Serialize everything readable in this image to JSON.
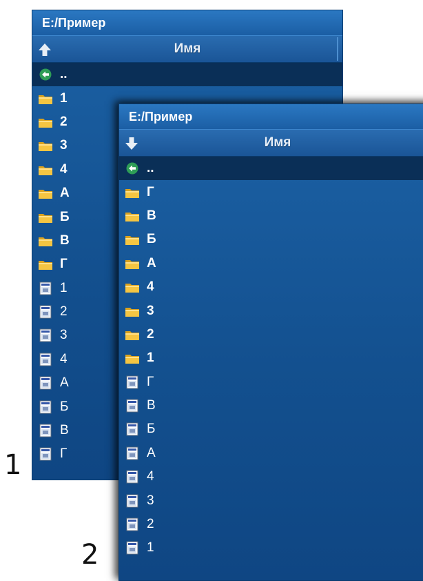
{
  "panels": [
    {
      "title": "E:/Пример",
      "column_header": "Имя",
      "sort_icon": "arrow-up-icon",
      "parent_label": "..",
      "items": [
        {
          "type": "dir",
          "label": "1"
        },
        {
          "type": "dir",
          "label": "2"
        },
        {
          "type": "dir",
          "label": "3"
        },
        {
          "type": "dir",
          "label": "4"
        },
        {
          "type": "dir",
          "label": "А"
        },
        {
          "type": "dir",
          "label": "Б"
        },
        {
          "type": "dir",
          "label": "В"
        },
        {
          "type": "dir",
          "label": "Г"
        },
        {
          "type": "file",
          "label": "1"
        },
        {
          "type": "file",
          "label": "2"
        },
        {
          "type": "file",
          "label": "3"
        },
        {
          "type": "file",
          "label": "4"
        },
        {
          "type": "file",
          "label": "А"
        },
        {
          "type": "file",
          "label": "Б"
        },
        {
          "type": "file",
          "label": "В"
        },
        {
          "type": "file",
          "label": "Г"
        }
      ]
    },
    {
      "title": "E:/Пример",
      "column_header": "Имя",
      "sort_icon": "arrow-down-icon",
      "parent_label": "..",
      "items": [
        {
          "type": "dir",
          "label": "Г"
        },
        {
          "type": "dir",
          "label": "В"
        },
        {
          "type": "dir",
          "label": "Б"
        },
        {
          "type": "dir",
          "label": "А"
        },
        {
          "type": "dir",
          "label": "4"
        },
        {
          "type": "dir",
          "label": "3"
        },
        {
          "type": "dir",
          "label": "2"
        },
        {
          "type": "dir",
          "label": "1"
        },
        {
          "type": "file",
          "label": "Г"
        },
        {
          "type": "file",
          "label": "В"
        },
        {
          "type": "file",
          "label": "Б"
        },
        {
          "type": "file",
          "label": "А"
        },
        {
          "type": "file",
          "label": "4"
        },
        {
          "type": "file",
          "label": "3"
        },
        {
          "type": "file",
          "label": "2"
        },
        {
          "type": "file",
          "label": "1"
        }
      ]
    }
  ],
  "markers": {
    "first": "1",
    "second": "2"
  },
  "colors": {
    "panel_bg": "#13508f",
    "title_bg": "#2b78c2",
    "parent_row_bg": "#0a2f57",
    "folder": "#f5c542",
    "back_icon": "#2e9d57"
  }
}
